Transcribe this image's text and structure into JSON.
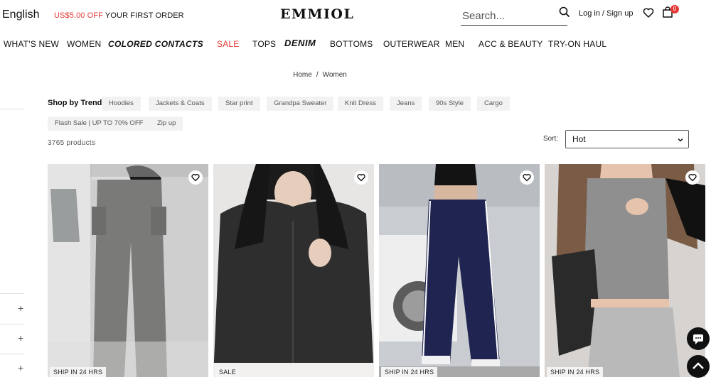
{
  "topbar": {
    "language": "English",
    "promo_amount": "US$5.00 OFF",
    "promo_rest": " YOUR FIRST ORDER",
    "logo": "EMMIOL",
    "search_placeholder": "Search...",
    "login": "Log in / Sign up",
    "cart_count": "0"
  },
  "nav": {
    "items": [
      "WHAT'S NEW",
      "WOMEN",
      "COLORED CONTACTS",
      "SALE",
      "TOPS",
      "DENIM",
      "BOTTOMS",
      "OUTERWEAR",
      "MEN",
      "ACC & BEAUTY",
      "TRY-ON HAUL"
    ]
  },
  "breadcrumb": {
    "home": "Home",
    "sep": "/",
    "current": "Women"
  },
  "trends": {
    "label": "Shop by Trend:",
    "chips": [
      "Hoodies",
      "Jackets & Coats",
      "Star print",
      "Grandpa Sweater",
      "Knit Dress",
      "Jeans",
      "90s Style",
      "Cargo",
      "Flash Sale | UP TO 70% OFF",
      "Zip up"
    ]
  },
  "listing": {
    "count": "3765 products",
    "sort_label": "Sort:",
    "sort_value": "Hot"
  },
  "products": [
    {
      "tag": "SHIP IN 24 HRS",
      "icon": "cargo-pants-photo"
    },
    {
      "tag": "SALE",
      "icon": "bomber-jacket-photo"
    },
    {
      "tag": "SHIP IN 24 HRS",
      "icon": "track-pants-photo"
    },
    {
      "tag": "SHIP IN 24 HRS",
      "icon": "grey-top-photo"
    }
  ],
  "colors": {
    "accent": "#e53935",
    "chip_bg": "#f2f2f2",
    "text": "#111111"
  }
}
